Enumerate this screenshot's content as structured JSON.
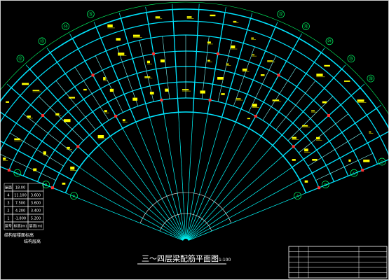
{
  "drawing": {
    "title": "三～四层梁配筋平面图",
    "scale": "1:100",
    "colors": {
      "background": "#000000",
      "grid": "#00ffff",
      "beam": "#00e5ff",
      "rebar_text": "#ffff00",
      "column": "#ff3030",
      "dim": "#00ff66",
      "frame": "#ffffff"
    },
    "axis_bubbles": [
      "⑧",
      "⑨",
      "⑩",
      "⑪",
      "⑫",
      "⑬",
      "⑭",
      "⑮",
      "⑯",
      "⑰",
      "⑱",
      "⑲",
      "⑳",
      "㉑",
      "㉒",
      "㉓",
      "㉔",
      "㉕",
      "㉖",
      "㉗",
      "㉘",
      "㉙"
    ]
  },
  "floor_table": {
    "rows": [
      [
        "屋面",
        "18.00",
        ""
      ],
      [
        "4",
        "11.100",
        "3.600"
      ],
      [
        "3",
        "7.500",
        "3.600"
      ],
      [
        "2",
        "4.200",
        "3.400"
      ],
      [
        "1",
        "-1.800",
        "5.200"
      ],
      [
        "层号",
        "标高(m)",
        "层高(m)"
      ]
    ],
    "footer_1": "结构层楼面标高",
    "footer_2": "结构层高"
  },
  "title_block": {
    "rows": [
      [
        "",
        "",
        ""
      ],
      [
        "",
        "",
        ""
      ],
      [
        "",
        "",
        ""
      ],
      [
        "",
        "",
        ""
      ],
      [
        "",
        "",
        ""
      ],
      [
        "",
        "",
        ""
      ]
    ]
  }
}
